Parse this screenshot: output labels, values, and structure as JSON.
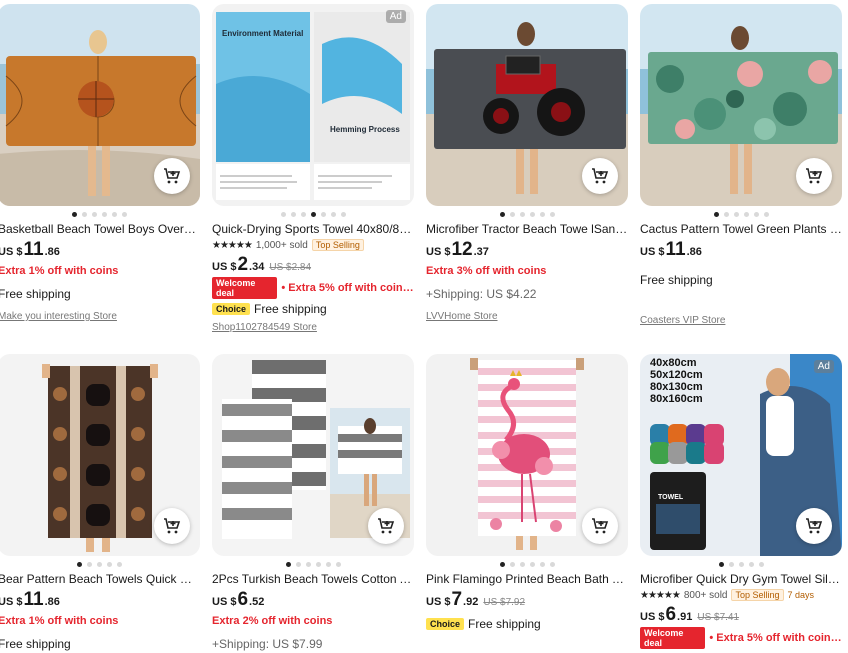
{
  "products": [
    {
      "title": "Basketball Beach Towel Boys Oversi…",
      "currency": "US $",
      "price_int": "11",
      "price_dec": ".86",
      "coins": "Extra 1% off with coins",
      "shipping": "Free shipping",
      "store": "Make you interesting Store"
    },
    {
      "title": "Quick-Drying Sports Towel 40x80/8…",
      "rating_stars": "★★★★★",
      "sold": "1,000+ sold",
      "badge": "Top Selling",
      "currency": "US $",
      "price_int": "2",
      "price_dec": ".34",
      "orig": "US $2.84",
      "welcome_tag": "Welcome deal",
      "welcome_text": "• Extra 5% off with coins…",
      "choice": "Choice",
      "shipping": "Free shipping",
      "store": "Shop1102784549 Store",
      "ad": "Ad",
      "img_text_top": "Environment Material",
      "img_text_mid": "Hemming Process"
    },
    {
      "title": "Microfiber Tractor Beach Towe lSan…",
      "currency": "US $",
      "price_int": "12",
      "price_dec": ".37",
      "coins": "Extra 3% off with coins",
      "shipping": "+Shipping: US $4.22",
      "store": "LVVHome Store"
    },
    {
      "title": "Cactus Pattern Towel Green Plants …",
      "currency": "US $",
      "price_int": "11",
      "price_dec": ".86",
      "shipping": "Free shipping",
      "store": "Coasters VIP Store"
    },
    {
      "title": "Bear Pattern Beach Towels Quick Dr…",
      "currency": "US $",
      "price_int": "11",
      "price_dec": ".86",
      "coins": "Extra 1% off with coins",
      "shipping": "Free shipping"
    },
    {
      "title": "2Pcs Turkish Beach Towels Cotton A…",
      "currency": "US $",
      "price_int": "6",
      "price_dec": ".52",
      "coins": "Extra 2% off with coins",
      "shipping": "+Shipping: US $7.99"
    },
    {
      "title": "Pink Flamingo Printed Beach Bath T…",
      "currency": "US $",
      "price_int": "7",
      "price_dec": ".92",
      "orig": "US $7.92",
      "choice": "Choice",
      "shipping": "Free shipping"
    },
    {
      "title": "Microfiber Quick Dry Gym Towel Sil…",
      "rating_stars": "★★★★★",
      "sold": "800+ sold",
      "badge": "Top Selling",
      "badge_days": "7 days",
      "currency": "US $",
      "price_int": "6",
      "price_dec": ".91",
      "orig": "US $7.41",
      "welcome_tag": "Welcome deal",
      "welcome_text": "• Extra 5% off with coins…",
      "ad": "Ad",
      "sizes": [
        "40x80cm",
        "50x120cm",
        "80x130cm",
        "80x160cm"
      ],
      "brand": "TOWEL"
    }
  ],
  "colors": {
    "accent_red": "#e5252e",
    "choice_yellow": "#ffe14f",
    "top_selling": "#b25d00"
  }
}
